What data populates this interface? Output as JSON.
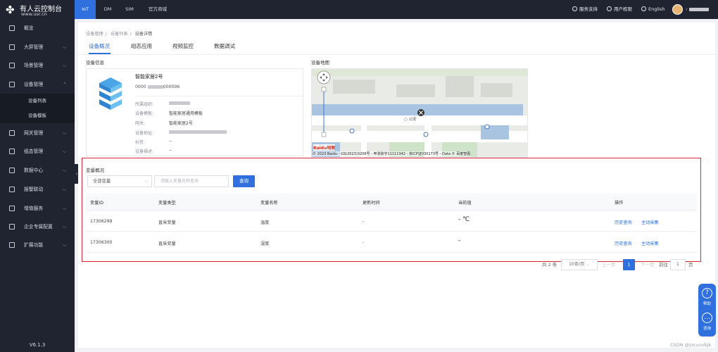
{
  "brand": {
    "title": "有人云控制台",
    "url": "www.usr.cn"
  },
  "top_tabs": [
    {
      "label": "IoT",
      "active": true
    },
    {
      "label": "DM",
      "active": false
    },
    {
      "label": "SIM",
      "active": false
    },
    {
      "label": "官方商城",
      "active": false
    }
  ],
  "top_right": {
    "support": "服务支持",
    "permissions": "用户权限",
    "language": "English"
  },
  "sidebar": {
    "items": [
      {
        "label": "概览",
        "icon": "overview-icon"
      },
      {
        "label": "大屏管理",
        "icon": "screen-icon"
      },
      {
        "label": "场景管理",
        "icon": "scene-icon"
      },
      {
        "label": "设备管理",
        "icon": "device-icon"
      },
      {
        "label": "网关管理",
        "icon": "gateway-icon"
      },
      {
        "label": "组态管理",
        "icon": "config-icon"
      },
      {
        "label": "数据中心",
        "icon": "chart-icon"
      },
      {
        "label": "报警联动",
        "icon": "alarm-icon"
      },
      {
        "label": "增值服务",
        "icon": "service-icon"
      },
      {
        "label": "企业专属配置",
        "icon": "enterprise-icon"
      },
      {
        "label": "扩展功能",
        "icon": "extension-icon"
      }
    ],
    "sub_items": [
      {
        "label": "设备列表"
      },
      {
        "label": "设备模板"
      }
    ],
    "version": "V6.1.3"
  },
  "breadcrumb": [
    "设备管理",
    "设备列表",
    "设备详情"
  ],
  "tabs": [
    {
      "label": "设备概况",
      "active": true
    },
    {
      "label": "组态应用",
      "active": false
    },
    {
      "label": "视频监控",
      "active": false
    },
    {
      "label": "数据调试",
      "active": false
    }
  ],
  "device_info": {
    "section_title": "设备信息",
    "name": "智能家居2号",
    "sn_prefix": "0000",
    "sn_suffix": "000006",
    "fields": [
      {
        "label": "所属组织:",
        "value": ""
      },
      {
        "label": "设备模板:",
        "value": "智能家居通用模板"
      },
      {
        "label": "网关:",
        "value": "智能家居2号"
      },
      {
        "label": "设备地址:",
        "value": ""
      },
      {
        "label": "标签:",
        "value": "--"
      },
      {
        "label": "设备描述:",
        "value": "--"
      }
    ]
  },
  "device_map": {
    "section_title": "设备地图",
    "poi_label": "公安",
    "copyright": "© 2023 Baidu - GS(2023)3206号 - 甲测资字11111342 - 京ICP证030173号 - Data © 百度智图",
    "logo": "Baidu地图"
  },
  "variables": {
    "section_title": "变量概况",
    "filter_select": "全部变量",
    "search_placeholder": "请输入变量名称查询",
    "query_button": "查询",
    "columns": [
      "变量ID",
      "变量类型",
      "变量名称",
      "更新时间",
      "当前值",
      "操作"
    ],
    "rows": [
      {
        "id": "17306299",
        "type": "直采变量",
        "name": "温度",
        "time": "-",
        "value": "- ℃",
        "action1": "历史查询",
        "action2": "主动采集"
      },
      {
        "id": "17306300",
        "type": "直采变量",
        "name": "湿度",
        "time": "-",
        "value": "-",
        "action1": "历史查询",
        "action2": "主动采集"
      }
    ]
  },
  "pagination": {
    "total": "共 2 条",
    "page_size": "10条/页",
    "prev": "上一页",
    "current": "1",
    "next": "下一页",
    "goto_label": "前往",
    "goto_value": "1",
    "page_unit": "页"
  },
  "float_help": {
    "help": "帮助",
    "consult": "咨询"
  },
  "watermark": "CSDN @zrcuovbjk",
  "colors": {
    "accent": "#2f6fde",
    "sidebar_bg": "#1f2430",
    "highlight_frame": "#d9283a"
  }
}
